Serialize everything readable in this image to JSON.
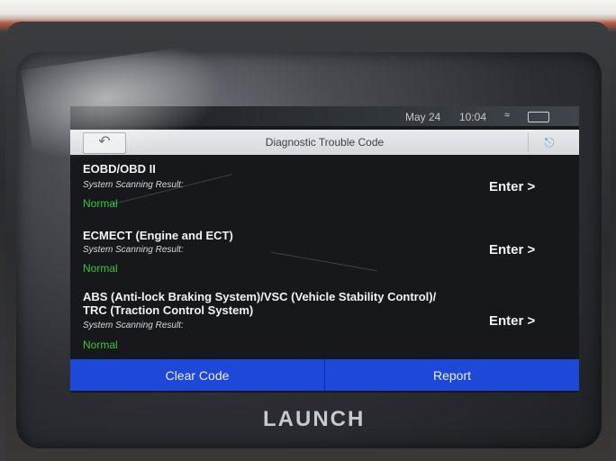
{
  "status_bar": {
    "date": "May 24",
    "time": "10:04"
  },
  "title_bar": {
    "title": "Diagnostic Trouble Code"
  },
  "results": [
    {
      "name_lines": [
        "EOBD/OBD II"
      ],
      "subtitle": "System Scanning Result:",
      "status": "Normal",
      "action": "Enter >"
    },
    {
      "name_lines": [
        "ECMECT (Engine and ECT)"
      ],
      "subtitle": "System Scanning Result:",
      "status": "Normal",
      "action": "Enter >"
    },
    {
      "name_lines": [
        "ABS (Anti-lock Braking System)/VSC (Vehicle Stability Control)/",
        "TRC (Traction Control System)"
      ],
      "subtitle": "System Scanning Result:",
      "status": "Normal",
      "action": "Enter >"
    }
  ],
  "bottom_buttons": {
    "clear_code": "Clear Code",
    "report": "Report"
  },
  "brand": {
    "logo_text": "LAUNCH"
  },
  "colors": {
    "accent_blue": "#1e49d8",
    "normal_green": "#3ac43a",
    "screen_bg": "#16181c"
  }
}
